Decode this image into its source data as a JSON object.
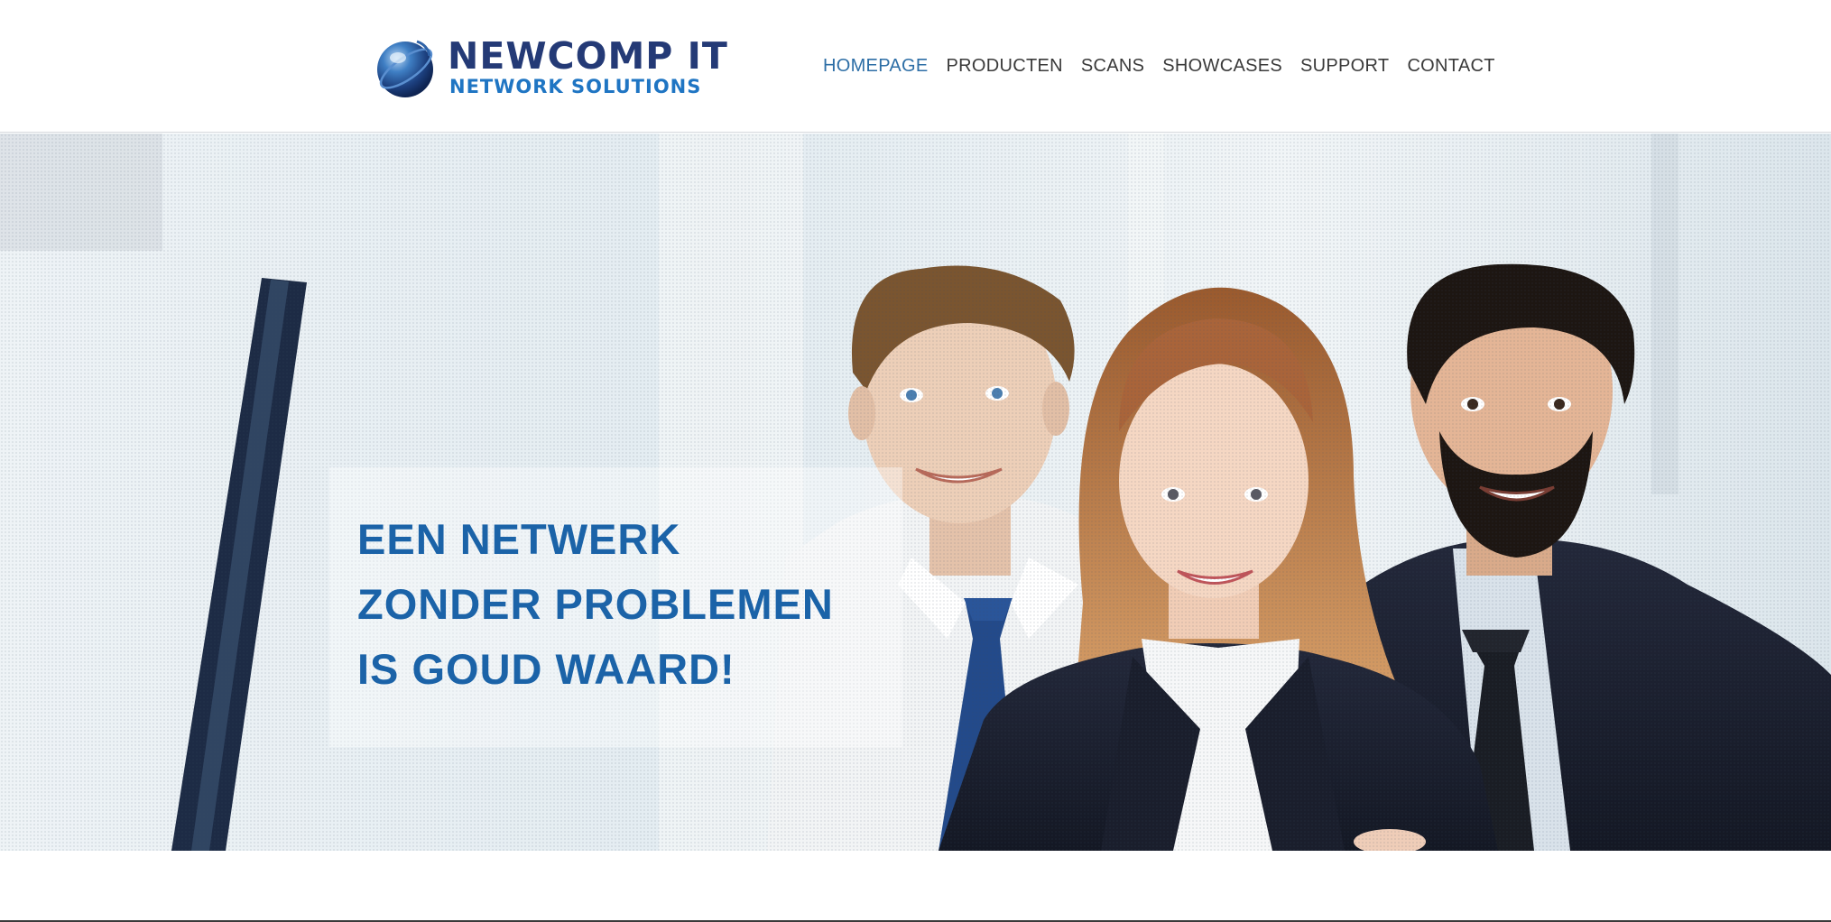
{
  "brand": {
    "name_line1": "NEWCOMP IT",
    "name_line2": "NETWORK SOLUTIONS",
    "colors": {
      "primary_dark": "#243a76",
      "primary_light": "#1f75c3",
      "nav_active": "#2d6ea6",
      "headline": "#1b63a8"
    },
    "icon": "globe-icon"
  },
  "nav": {
    "items": [
      {
        "label": "HOMEPAGE",
        "active": true
      },
      {
        "label": "PRODUCTEN",
        "active": false
      },
      {
        "label": "SCANS",
        "active": false
      },
      {
        "label": "SHOWCASES",
        "active": false
      },
      {
        "label": "SUPPORT",
        "active": false
      },
      {
        "label": "CONTACT",
        "active": false
      }
    ]
  },
  "hero": {
    "headline_lines": [
      "EEN NETWERK",
      "ZONDER PROBLEMEN",
      "IS GOUD WAARD!"
    ]
  }
}
